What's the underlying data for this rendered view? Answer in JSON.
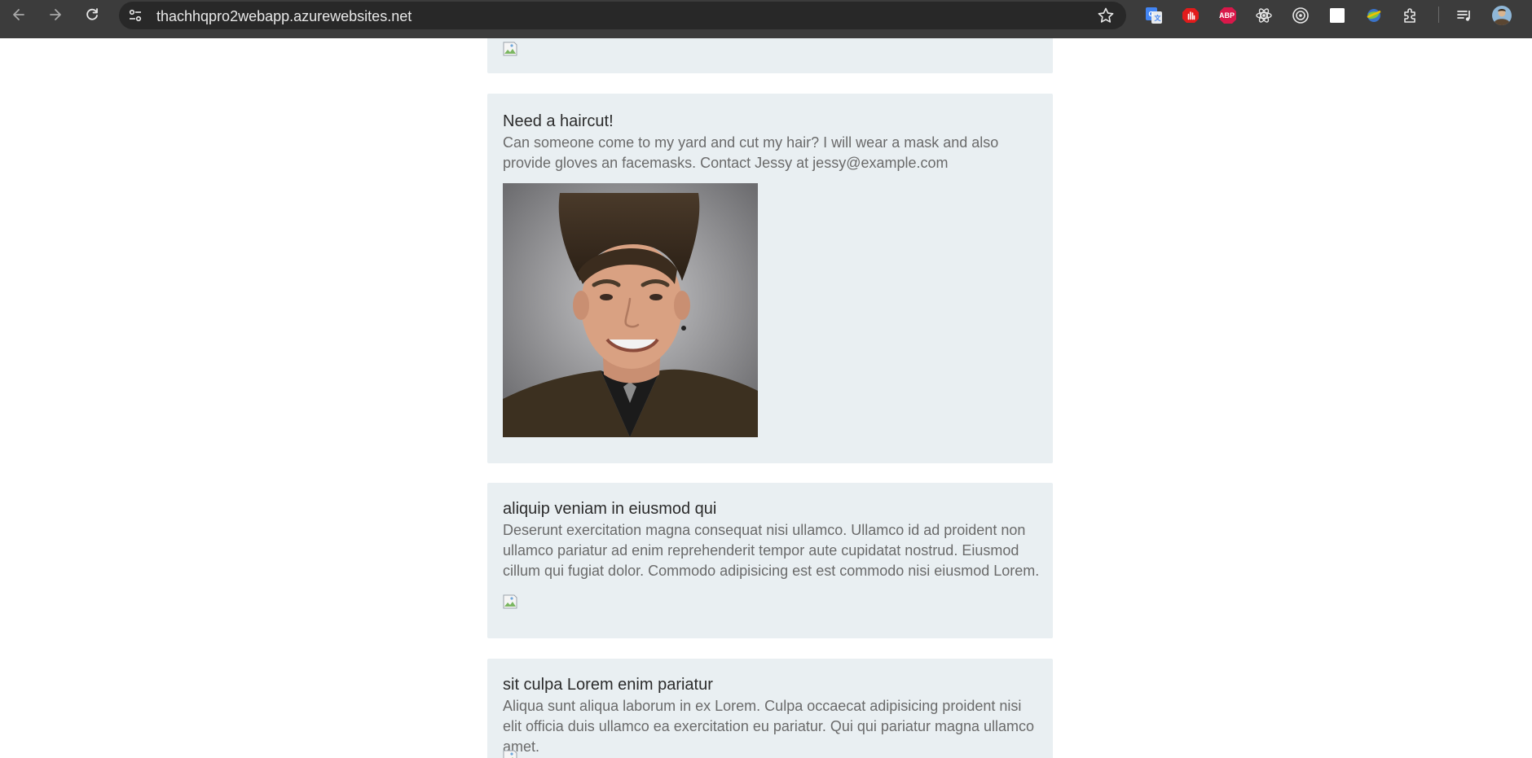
{
  "browser": {
    "url": "thachhqpro2webapp.azurewebsites.net",
    "icons": {
      "back": "arrow-left-icon",
      "forward": "arrow-right-icon",
      "reload": "reload-icon",
      "site_info": "tune-icon",
      "bookmark": "star-icon"
    },
    "extensions": [
      "google-translate-icon",
      "stop-hand-icon",
      "adblock-plus-icon",
      "react-devtools-icon",
      "target-icon",
      "white-square-icon",
      "colorful-globe-icon",
      "puzzle-extensions-icon",
      "playlist-icon",
      "profile-avatar-icon"
    ],
    "abp_label": "ABP"
  },
  "posts": [
    {
      "title": "",
      "body": "",
      "image": "broken-image"
    },
    {
      "title": "Need a haircut!",
      "body": "Can someone come to my yard and cut my hair? I will wear a mask and also provide gloves an facemasks. Contact Jessy at jessy@example.com",
      "image": "portrait-photo"
    },
    {
      "title": "aliquip veniam in eiusmod qui",
      "body": "Deserunt exercitation magna consequat nisi ullamco. Ullamco id ad proident non ullamco pariatur ad enim reprehenderit tempor aute cupidatat nostrud. Eiusmod cillum qui fugiat dolor. Commodo adipisicing est est commodo nisi eiusmod Lorem.",
      "image": "broken-image"
    },
    {
      "title": "sit culpa Lorem enim pariatur",
      "body": "Aliqua sunt aliqua laborum in ex Lorem. Culpa occaecat adipisicing proident nisi elit officia duis ullamco ea exercitation eu pariatur. Qui qui pariatur magna ullamco amet.",
      "image": "broken-image"
    }
  ],
  "colors": {
    "chrome_bg": "#3c3c3c",
    "omnibox_bg": "#282828",
    "card_bg": "#e9eff2",
    "title_text": "#2b2b2b",
    "body_text": "#6a6a6a"
  }
}
